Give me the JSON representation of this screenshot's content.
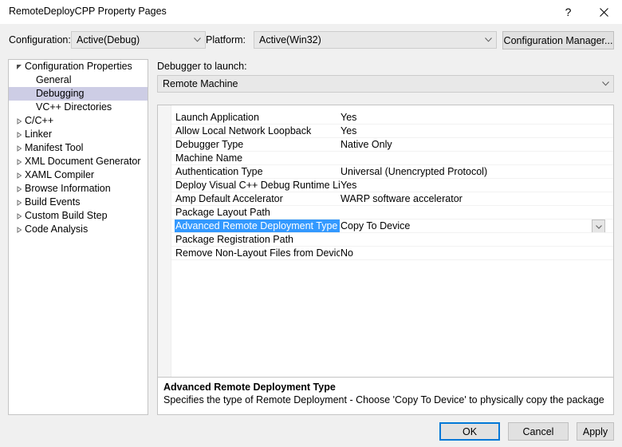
{
  "window": {
    "title": "RemoteDeployCPP Property Pages",
    "help_icon": "?",
    "close_icon": "close-icon"
  },
  "configbar": {
    "configuration_label": "Configuration:",
    "configuration_value": "Active(Debug)",
    "platform_label": "Platform:",
    "platform_value": "Active(Win32)",
    "configuration_manager_label": "Configuration Manager..."
  },
  "tree": {
    "items": [
      {
        "label": "Configuration Properties",
        "level": 0,
        "twisty": "expanded",
        "selected": false
      },
      {
        "label": "General",
        "level": 1,
        "twisty": "none",
        "selected": false
      },
      {
        "label": "Debugging",
        "level": 1,
        "twisty": "none",
        "selected": true
      },
      {
        "label": "VC++ Directories",
        "level": 1,
        "twisty": "none",
        "selected": false
      },
      {
        "label": "C/C++",
        "level": 0,
        "twisty": "collapsed",
        "selected": false
      },
      {
        "label": "Linker",
        "level": 0,
        "twisty": "collapsed",
        "selected": false
      },
      {
        "label": "Manifest Tool",
        "level": 0,
        "twisty": "collapsed",
        "selected": false
      },
      {
        "label": "XML Document Generator",
        "level": 0,
        "twisty": "collapsed",
        "selected": false
      },
      {
        "label": "XAML Compiler",
        "level": 0,
        "twisty": "collapsed",
        "selected": false
      },
      {
        "label": "Browse Information",
        "level": 0,
        "twisty": "collapsed",
        "selected": false
      },
      {
        "label": "Build Events",
        "level": 0,
        "twisty": "collapsed",
        "selected": false
      },
      {
        "label": "Custom Build Step",
        "level": 0,
        "twisty": "collapsed",
        "selected": false
      },
      {
        "label": "Code Analysis",
        "level": 0,
        "twisty": "collapsed",
        "selected": false
      }
    ]
  },
  "main": {
    "debugger_to_launch_label": "Debugger to launch:",
    "debugger_to_launch_value": "Remote Machine",
    "properties": [
      {
        "name": "Launch Application",
        "value": "Yes",
        "selected": false
      },
      {
        "name": "Allow Local Network Loopback",
        "value": "Yes",
        "selected": false
      },
      {
        "name": "Debugger Type",
        "value": "Native Only",
        "selected": false
      },
      {
        "name": "Machine Name",
        "value": "",
        "selected": false
      },
      {
        "name": "Authentication Type",
        "value": "Universal (Unencrypted Protocol)",
        "selected": false
      },
      {
        "name": "Deploy Visual C++ Debug Runtime Librari",
        "value": "Yes",
        "selected": false
      },
      {
        "name": "Amp Default Accelerator",
        "value": "WARP software accelerator",
        "selected": false
      },
      {
        "name": "Package Layout Path",
        "value": "",
        "selected": false
      },
      {
        "name": "Advanced Remote Deployment Type",
        "value": "Copy To Device",
        "selected": true
      },
      {
        "name": "Package Registration Path",
        "value": "",
        "selected": false
      },
      {
        "name": "Remove Non-Layout Files from Device",
        "value": "No",
        "selected": false
      }
    ],
    "description": {
      "title": "Advanced Remote Deployment Type",
      "text": "Specifies the type of Remote Deployment - Choose 'Copy To Device' to physically copy the package layout to re..."
    }
  },
  "footer": {
    "ok_label": "OK",
    "cancel_label": "Cancel",
    "apply_label": "Apply"
  },
  "colors": {
    "selection_blue": "#3399ff",
    "tree_selection": "#cdcde5",
    "focus_border": "#0078d7",
    "dialog_background": "#f0f0f0"
  }
}
